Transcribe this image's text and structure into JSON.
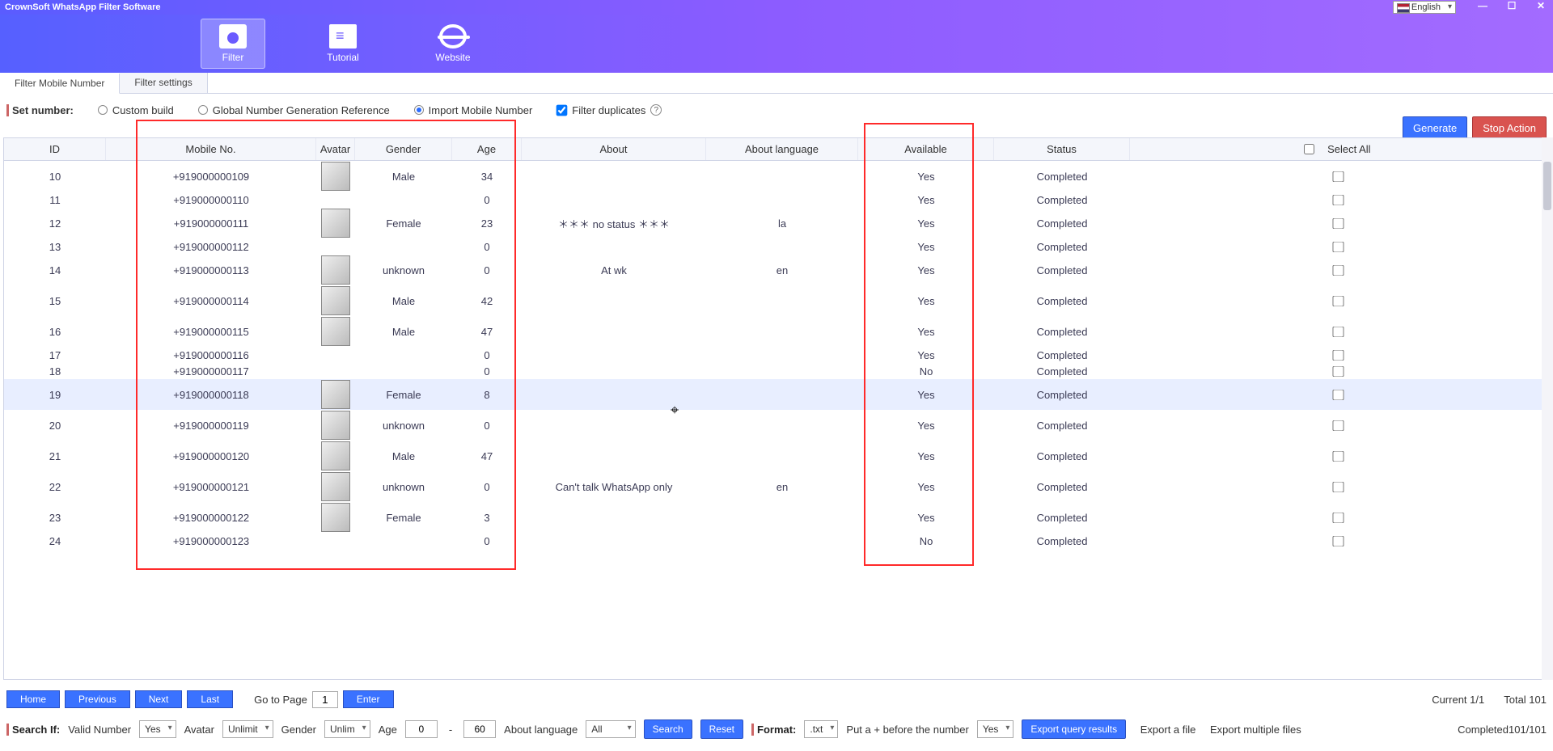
{
  "window": {
    "title": "CrownSoft WhatsApp Filter Software",
    "language": "English"
  },
  "ribbon": {
    "filter": "Filter",
    "tutorial": "Tutorial",
    "website": "Website"
  },
  "tabs": {
    "filter_mobile": "Filter Mobile Number",
    "filter_settings": "Filter settings"
  },
  "options": {
    "set_number_label": "Set number:",
    "custom_build": "Custom build",
    "global_ref": "Global Number Generation Reference",
    "import_mobile": "Import Mobile Number",
    "filter_duplicates": "Filter duplicates"
  },
  "buttons": {
    "generate": "Generate",
    "stop_action": "Stop Action",
    "search": "Search",
    "reset": "Reset",
    "export_query": "Export query results",
    "enter": "Enter",
    "home": "Home",
    "previous": "Previous",
    "next": "Next",
    "last": "Last"
  },
  "table": {
    "headers": {
      "id": "ID",
      "mobile": "Mobile No.",
      "avatar": "Avatar",
      "gender": "Gender",
      "age": "Age",
      "about": "About",
      "about_lang": "About language",
      "available": "Available",
      "status": "Status",
      "select_all": "Select All"
    },
    "rows": [
      {
        "id": "10",
        "mobile": "+919000000109",
        "avatar": "p1",
        "gender": "Male",
        "age": "34",
        "about": "",
        "lang": "",
        "available": "Yes",
        "status": "Completed",
        "tall": true
      },
      {
        "id": "11",
        "mobile": "+919000000110",
        "avatar": "",
        "gender": "",
        "age": "0",
        "about": "",
        "lang": "",
        "available": "Yes",
        "status": "Completed",
        "tall": false
      },
      {
        "id": "12",
        "mobile": "+919000000111",
        "avatar": "p2",
        "gender": "Female",
        "age": "23",
        "about": "＊＊＊ no status ＊＊＊",
        "lang": "la",
        "available": "Yes",
        "status": "Completed",
        "tall": true
      },
      {
        "id": "13",
        "mobile": "+919000000112",
        "avatar": "",
        "gender": "",
        "age": "0",
        "about": "",
        "lang": "",
        "available": "Yes",
        "status": "Completed",
        "tall": false
      },
      {
        "id": "14",
        "mobile": "+919000000113",
        "avatar": "p3",
        "gender": "unknown",
        "age": "0",
        "about": "At wk",
        "lang": "en",
        "available": "Yes",
        "status": "Completed",
        "tall": true
      },
      {
        "id": "15",
        "mobile": "+919000000114",
        "avatar": "p4",
        "gender": "Male",
        "age": "42",
        "about": "",
        "lang": "",
        "available": "Yes",
        "status": "Completed",
        "tall": true
      },
      {
        "id": "16",
        "mobile": "+919000000115",
        "avatar": "p5",
        "gender": "Male",
        "age": "47",
        "about": "",
        "lang": "",
        "available": "Yes",
        "status": "Completed",
        "tall": true
      },
      {
        "id": "17",
        "mobile": "+919000000116",
        "avatar": "",
        "gender": "",
        "age": "0",
        "about": "",
        "lang": "",
        "available": "Yes",
        "status": "Completed",
        "tall": false
      },
      {
        "id": "18",
        "mobile": "+919000000117",
        "avatar": "",
        "gender": "",
        "age": "0",
        "about": "",
        "lang": "",
        "available": "No",
        "status": "Completed",
        "tall": false
      },
      {
        "id": "19",
        "mobile": "+919000000118",
        "avatar": "p6",
        "gender": "Female",
        "age": "8",
        "about": "",
        "lang": "",
        "available": "Yes",
        "status": "Completed",
        "tall": true,
        "hover": true
      },
      {
        "id": "20",
        "mobile": "+919000000119",
        "avatar": "p7",
        "gender": "unknown",
        "age": "0",
        "about": "",
        "lang": "",
        "available": "Yes",
        "status": "Completed",
        "tall": true
      },
      {
        "id": "21",
        "mobile": "+919000000120",
        "avatar": "p8",
        "gender": "Male",
        "age": "47",
        "about": "",
        "lang": "",
        "available": "Yes",
        "status": "Completed",
        "tall": true
      },
      {
        "id": "22",
        "mobile": "+919000000121",
        "avatar": "p9",
        "gender": "unknown",
        "age": "0",
        "about": "Can't talk WhatsApp only",
        "lang": "en",
        "available": "Yes",
        "status": "Completed",
        "tall": true
      },
      {
        "id": "23",
        "mobile": "+919000000122",
        "avatar": "p10",
        "gender": "Female",
        "age": "3",
        "about": "",
        "lang": "",
        "available": "Yes",
        "status": "Completed",
        "tall": true
      },
      {
        "id": "24",
        "mobile": "+919000000123",
        "avatar": "",
        "gender": "",
        "age": "0",
        "about": "",
        "lang": "",
        "available": "No",
        "status": "Completed",
        "tall": false
      }
    ]
  },
  "pager": {
    "go_to_page": "Go to Page",
    "page_value": "1",
    "current": "Current 1/1",
    "total": "Total 101"
  },
  "search": {
    "label": "Search If:",
    "valid_number": "Valid Number",
    "valid_number_value": "Yes",
    "avatar_label": "Avatar",
    "avatar_value": "Unlimit",
    "gender_label": "Gender",
    "gender_value": "Unlim",
    "age_label": "Age",
    "age_from": "0",
    "age_to": "60",
    "about_lang_label": "About language",
    "about_lang_value": "All",
    "format_label": "Format:",
    "format_value": ".txt",
    "put_plus": "Put a + before the number",
    "put_plus_value": "Yes",
    "export_file": "Export a file",
    "export_multi": "Export multiple files",
    "completed": "Completed101/101"
  }
}
